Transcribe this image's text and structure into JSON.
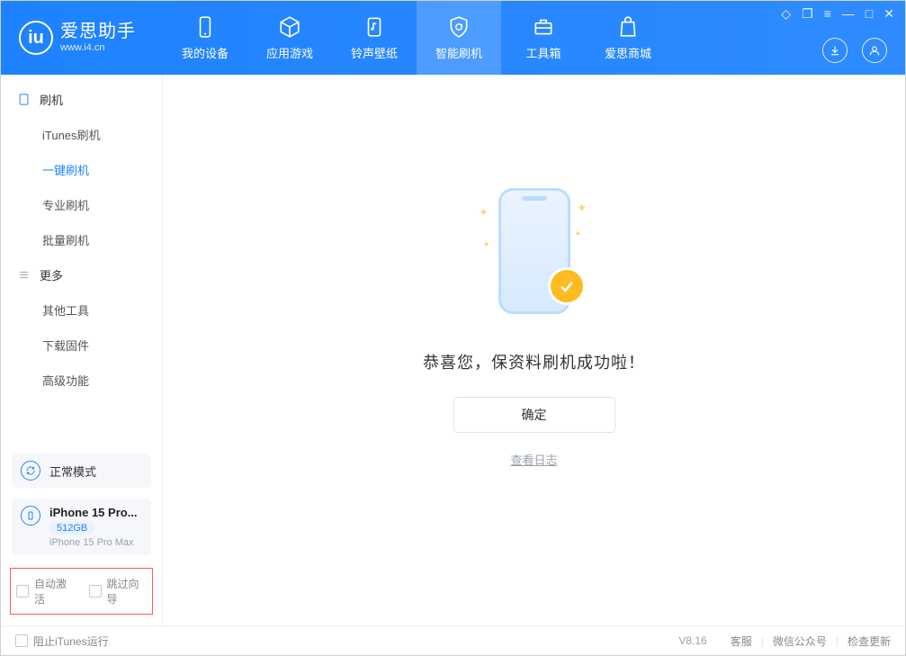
{
  "brand": {
    "title": "爱思助手",
    "subtitle": "www.i4.cn"
  },
  "nav": {
    "items": [
      {
        "label": "我的设备"
      },
      {
        "label": "应用游戏"
      },
      {
        "label": "铃声壁纸"
      },
      {
        "label": "智能刷机"
      },
      {
        "label": "工具箱"
      },
      {
        "label": "爱思商城"
      }
    ],
    "active_index": 3
  },
  "sidebar": {
    "group1": {
      "title": "刷机"
    },
    "items1": [
      {
        "label": "iTunes刷机"
      },
      {
        "label": "一键刷机"
      },
      {
        "label": "专业刷机"
      },
      {
        "label": "批量刷机"
      }
    ],
    "active_item1": 1,
    "group2": {
      "title": "更多"
    },
    "items2": [
      {
        "label": "其他工具"
      },
      {
        "label": "下载固件"
      },
      {
        "label": "高级功能"
      }
    ]
  },
  "device_mode": {
    "label": "正常模式"
  },
  "device": {
    "name": "iPhone 15 Pro...",
    "storage": "512GB",
    "full_name": "iPhone 15 Pro Max"
  },
  "options": {
    "auto_activate": "自动激活",
    "skip_guide": "跳过向导"
  },
  "main": {
    "success_text": "恭喜您，保资料刷机成功啦！",
    "ok_button": "确定",
    "log_link": "查看日志"
  },
  "footer": {
    "block_itunes": "阻止iTunes运行",
    "version": "V8.16",
    "links": {
      "support": "客服",
      "wechat": "微信公众号",
      "check_update": "检查更新"
    }
  }
}
